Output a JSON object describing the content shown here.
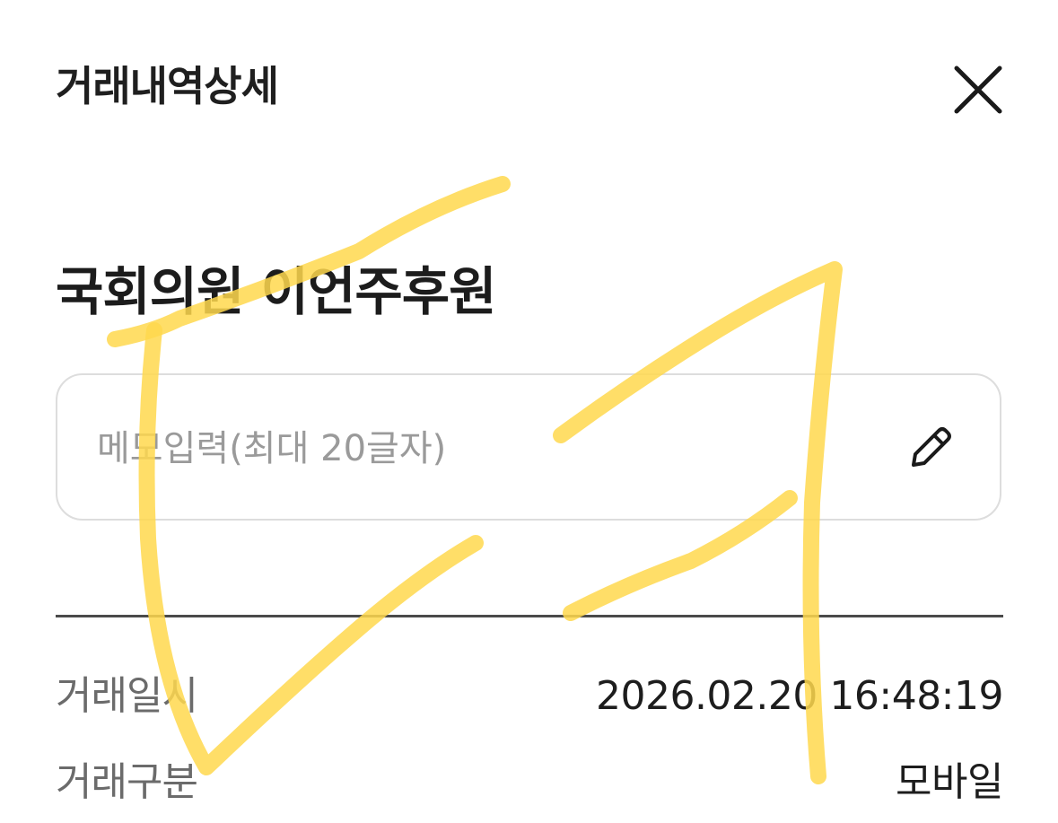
{
  "header": {
    "title": "거래내역상세",
    "close_icon": "close-icon"
  },
  "merchant": {
    "name": "국회의원 이언주후원"
  },
  "memo": {
    "placeholder": "메모입력(최대 20글자)",
    "value": "",
    "edit_icon": "pencil-icon"
  },
  "details": [
    {
      "label": "거래일시",
      "value": "2026.02.20 16:48:19"
    },
    {
      "label": "거래구분",
      "value": "모바일"
    }
  ],
  "colors": {
    "highlighter": "#ffd84d",
    "divider": "#4a4a4a",
    "memo_border": "#dddddd",
    "label_text": "#6b6b6b"
  }
}
